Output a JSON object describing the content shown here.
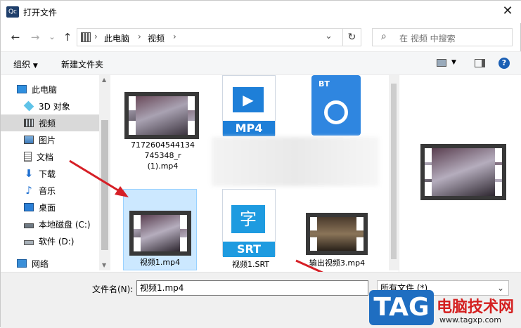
{
  "window": {
    "title": "打开文件",
    "app_icon": "Qc"
  },
  "nav": {
    "path": [
      "此电脑",
      "视频"
    ],
    "search_placeholder": "在 视频 中搜索"
  },
  "toolbar": {
    "organize": "组织",
    "new_folder": "新建文件夹"
  },
  "sidebar": {
    "items": [
      {
        "label": "此电脑",
        "icon": "computer-icon"
      },
      {
        "label": "3D 对象",
        "icon": "cube-icon"
      },
      {
        "label": "视频",
        "icon": "film-icon",
        "selected": true
      },
      {
        "label": "图片",
        "icon": "picture-icon"
      },
      {
        "label": "文档",
        "icon": "document-icon"
      },
      {
        "label": "下载",
        "icon": "download-icon"
      },
      {
        "label": "音乐",
        "icon": "music-icon"
      },
      {
        "label": "桌面",
        "icon": "desktop-icon"
      },
      {
        "label": "本地磁盘 (C:)",
        "icon": "drive-icon"
      },
      {
        "label": "软件 (D:)",
        "icon": "drive-icon"
      },
      {
        "label": "网络",
        "icon": "network-icon"
      }
    ]
  },
  "files": [
    {
      "name": "7172604544134745348_r(1).mp4",
      "line1": "7172604544134",
      "line2": "745348_r",
      "line3": "(1).mp4"
    },
    {
      "name": "",
      "badge": "MP4"
    },
    {
      "name": "",
      "badge": "BT"
    },
    {
      "name": "视频1.mp4",
      "selected": true
    },
    {
      "name": "视频1.SRT",
      "badge": "SRT",
      "glyph": "字"
    },
    {
      "name": "输出视频3.mp4"
    }
  ],
  "bottom": {
    "filename_label": "文件名(N):",
    "filename_value": "视频1.mp4",
    "filetype": "所有文件 (*)"
  },
  "watermark": {
    "tag": "TAG",
    "text": "电脑技术网",
    "url": "www.tagxp.com"
  },
  "colors": {
    "accent": "#1a73e8",
    "selection": "#cce8ff",
    "arrow": "#d61f26"
  }
}
